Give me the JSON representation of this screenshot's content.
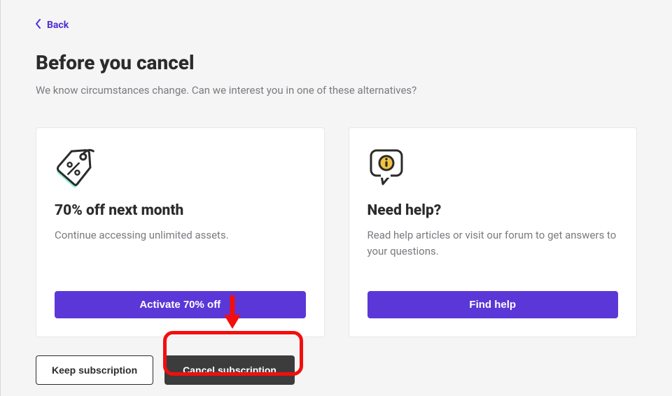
{
  "back_label": "Back",
  "title": "Before you cancel",
  "subtitle": "We know circumstances change. Can we interest you in one of these alternatives?",
  "card_offer": {
    "title": "70% off next month",
    "body": "Continue accessing unlimited assets.",
    "button": "Activate 70% off"
  },
  "card_help": {
    "title": "Need help?",
    "body": "Read help articles or visit our forum to get answers to your questions.",
    "button": "Find help"
  },
  "actions": {
    "keep": "Keep subscription",
    "cancel": "Cancel subscription"
  }
}
